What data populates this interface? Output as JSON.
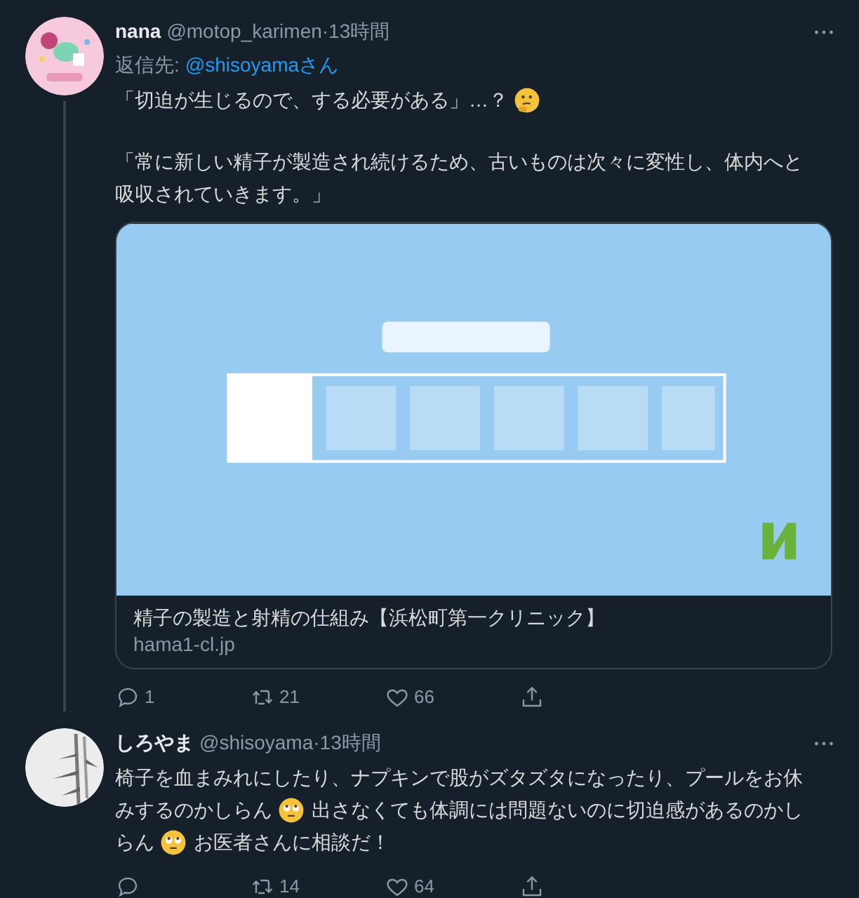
{
  "tweets": [
    {
      "name": "nana",
      "handle": "@motop_karimen",
      "time": "·13時間",
      "avatar": {
        "kind": "picture"
      },
      "thread_line": true,
      "reply_to": {
        "label": "返信先:",
        "handle": "@shisoyamaさん"
      },
      "body": [
        [
          [
            {
              "kind": "text",
              "text": "「切迫が生じるので、する必要がある」…？"
            },
            {
              "kind": "thinking"
            }
          ]
        ],
        [
          [
            {
              "kind": "text",
              "text": "「常に新しい精子が製造され続けるため、古いものは次々に変性し、体内へと"
            }
          ],
          [
            {
              "kind": "text",
              "text": "吸収されていきます。」"
            }
          ]
        ]
      ],
      "card": {
        "kind": "picture",
        "title": "精子の製造と射精の仕組み【浜松町第一クリニック】",
        "domain": "hama1-cl.jp"
      },
      "actions": [
        {
          "kind": "reply",
          "count": "1"
        },
        {
          "kind": "retweet",
          "count": "21"
        },
        {
          "kind": "like",
          "count": "66"
        },
        {
          "kind": "share"
        }
      ]
    },
    {
      "name": "しろやま",
      "handle": "@shisoyama",
      "time": "·13時間",
      "avatar": {
        "kind": "picture"
      },
      "thread_line": false,
      "body": [
        [
          [
            {
              "kind": "text",
              "text": "椅子を血まみれにしたり、ナプキンで股がズタズタになったり、プールをお休"
            }
          ],
          [
            {
              "kind": "text",
              "text": "みするのかしらん"
            },
            {
              "kind": "eyeroll"
            },
            {
              "kind": "text",
              "text": "出さなくても体調には問題ないのに切迫感があるのかし"
            }
          ],
          [
            {
              "kind": "text",
              "text": "らん"
            },
            {
              "kind": "eyeroll"
            },
            {
              "kind": "text",
              "text": "お医者さんに相談だ！"
            }
          ]
        ]
      ],
      "actions": [
        {
          "kind": "reply"
        },
        {
          "kind": "retweet",
          "count": "14"
        },
        {
          "kind": "like",
          "count": "64"
        },
        {
          "kind": "share"
        }
      ]
    }
  ]
}
